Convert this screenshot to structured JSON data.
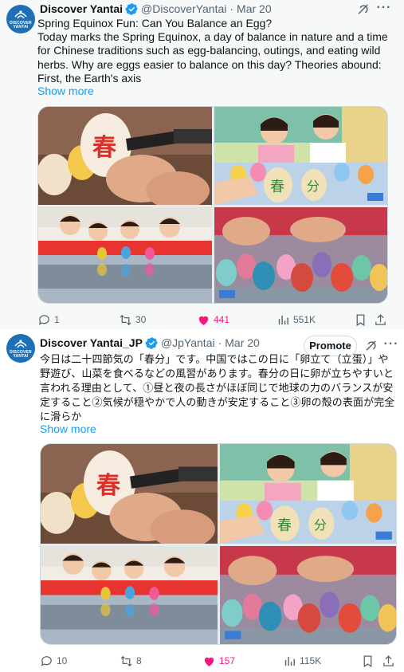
{
  "tweets": [
    {
      "author": {
        "name": "Discover Yantai",
        "handle": "@DiscoverYantai",
        "date": "Mar 20",
        "avatar_text": "DISCOVER\nYANTAI"
      },
      "text": "Spring Equinox Fun: Can You Balance an Egg?\nToday marks the Spring Equinox, a day of balance in nature and a time for Chinese traditions such as egg-balancing, outings, and eating wild herbs. Why are eggs easier to balance on this day? Theories abound: First, the Earth's axis",
      "show_more": "Show more",
      "stats": {
        "replies": "1",
        "retweets": "30",
        "likes": "441",
        "views": "551K"
      },
      "liked": true
    },
    {
      "author": {
        "name": "Discover Yantai_JP",
        "handle": "@JpYantai",
        "date": "Mar 20",
        "avatar_text": "DISCOVER\nYANTAI"
      },
      "promote_label": "Promote",
      "text": "今日は二十四節気の「春分」です。中国ではこの日に「卵立て（立蛋）」や野遊び、山菜を食べるなどの風習があります。春分の日に卵が立ちやすいと言われる理由として、①昼と夜の長さがほぼ同じで地球の力のバランスが安定すること②気候が穏やかで人の動きが安定すること③卵の殻の表面が完全に滑らか",
      "show_more": "Show more",
      "stats": {
        "replies": "10",
        "retweets": "8",
        "likes": "157",
        "views": "115K"
      },
      "liked": true
    }
  ],
  "media": {
    "egg_character": "春",
    "egg_characters": [
      "春",
      "分"
    ],
    "watermark": "新华社"
  },
  "colors": {
    "accent": "#1d9bf0",
    "like": "#f91880",
    "secondary": "#536471",
    "avatar": "#1d6fb8"
  },
  "icons": [
    "verified-badge-icon",
    "grok-icon",
    "more-icon",
    "reply-icon",
    "retweet-icon",
    "like-icon",
    "views-icon",
    "bookmark-icon",
    "share-icon"
  ]
}
